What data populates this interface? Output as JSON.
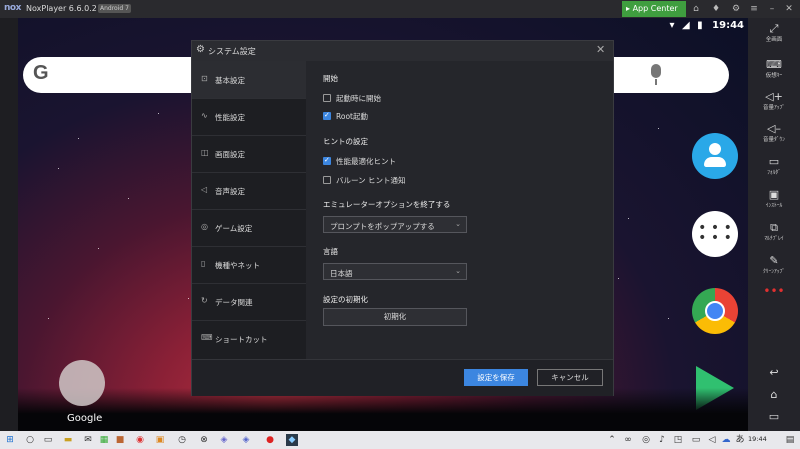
{
  "window": {
    "logo": "nox",
    "title": "NoxPlayer 6.6.0.2",
    "android_badge": "Android 7",
    "app_center": "App Center"
  },
  "statusbar": {
    "time": "19:44"
  },
  "android": {
    "google_label": "Google",
    "search_logo": "G"
  },
  "rightbar": {
    "items": [
      {
        "icon": "fullscreen-icon",
        "label": "全画面"
      },
      {
        "icon": "virtual-key-icon",
        "label": "仮想ｷｰ"
      },
      {
        "icon": "volume-up-icon",
        "label": "音量ｱｯﾌﾟ"
      },
      {
        "icon": "volume-down-icon",
        "label": "音量ﾀﾞｳﾝ"
      },
      {
        "icon": "folder-icon",
        "label": "ﾌｫﾙﾀﾞ"
      },
      {
        "icon": "install-icon",
        "label": "ｲﾝｽﾄｰﾙ"
      },
      {
        "icon": "multi-drive-icon",
        "label": "ﾏﾙﾁﾌﾟﾚｲ"
      },
      {
        "icon": "cleanup-icon",
        "label": "ｸﾘｰﾝｱｯﾌﾟ"
      }
    ]
  },
  "dialog": {
    "title": "システム設定",
    "nav": [
      {
        "icon": "gamepad-icon",
        "label": "基本設定"
      },
      {
        "icon": "pulse-icon",
        "label": "性能設定"
      },
      {
        "icon": "display-icon",
        "label": "画面設定"
      },
      {
        "icon": "speaker-icon",
        "label": "音声設定"
      },
      {
        "icon": "game-icon",
        "label": "ゲーム設定"
      },
      {
        "icon": "device-icon",
        "label": "機種やネット"
      },
      {
        "icon": "history-icon",
        "label": "データ関連"
      },
      {
        "icon": "keyboard-icon",
        "label": "ショートカット"
      }
    ],
    "content": {
      "start_header": "開始",
      "autostart_label": "起動時に開始",
      "root_label": "Root起動",
      "hint_header": "ヒントの設定",
      "perf_hint_label": "性能最適化ヒント",
      "balloon_label": "バルーン ヒント通知",
      "exit_header": "エミュレーターオプションを終了する",
      "exit_value": "プロンプトをポップアップする",
      "lang_header": "言語",
      "lang_value": "日本語",
      "reset_header": "設定の初期化",
      "reset_button": "初期化"
    },
    "save_button": "設定を保存",
    "cancel_button": "キャンセル"
  },
  "taskbar": {
    "time": "19:44"
  },
  "colors": {
    "accent": "#3c86e0",
    "appcenter": "#3f9e3f"
  }
}
